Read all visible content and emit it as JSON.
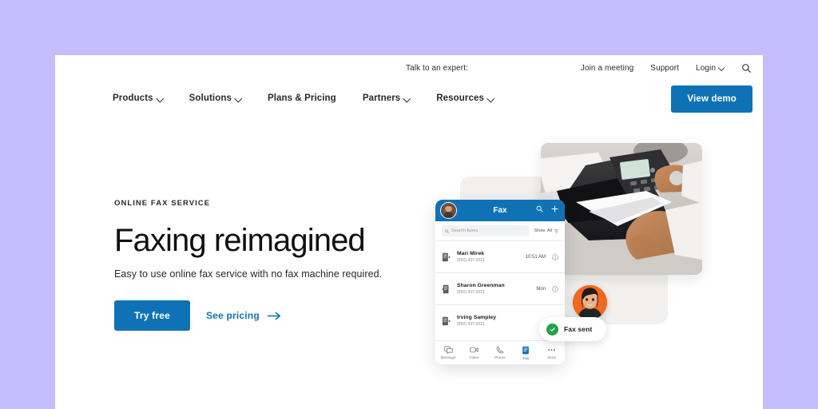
{
  "theme": {
    "page_background": "#c5bdfd",
    "surface": "#ffffff",
    "brand_blue": "#0f72b6",
    "text_dark": "#2b2926",
    "headline_color": "#13110e",
    "success_green": "#22a24a",
    "avatar_orange": "#f2681c",
    "card_gray": "#f1f0ee"
  },
  "utility_nav": {
    "expert_label": "Talk to an expert:",
    "links": [
      {
        "label": "Join a meeting",
        "has_chevron": false
      },
      {
        "label": "Support",
        "has_chevron": false
      },
      {
        "label": "Login",
        "has_chevron": true
      }
    ],
    "search_icon": "search-icon"
  },
  "main_nav": {
    "items": [
      {
        "label": "Products",
        "has_chevron": true
      },
      {
        "label": "Solutions",
        "has_chevron": true
      },
      {
        "label": "Plans & Pricing",
        "has_chevron": false
      },
      {
        "label": "Partners",
        "has_chevron": true
      },
      {
        "label": "Resources",
        "has_chevron": true
      }
    ],
    "cta_label": "View demo"
  },
  "hero": {
    "eyebrow": "ONLINE FAX SERVICE",
    "headline": "Faxing reimagined",
    "subhead": "Easy to use online fax service with no fax machine required.",
    "primary_cta": "Try free",
    "secondary_cta": "See pricing",
    "secondary_cta_icon": "arrow-right-icon"
  },
  "app_mockup": {
    "title": "Fax",
    "avatar_icon": "user-avatar",
    "bar_icons": [
      "search-icon",
      "plus-icon"
    ],
    "search_placeholder": "Search faxes",
    "filter_label": "Show: All",
    "filter_icon": "filter-icon",
    "rows": [
      {
        "icon": "fax-outgoing-icon",
        "name": "Mari Mirek",
        "number": "(650) 437-0221",
        "time": "10:51 AM",
        "info_icon": "info-icon"
      },
      {
        "icon": "fax-incoming-icon",
        "name": "Sharon Greenman",
        "number": "(650) 437-0221",
        "time": "Mon",
        "info_icon": "info-icon"
      },
      {
        "icon": "fax-outgoing-icon",
        "name": "Irving Sampley",
        "number": "(650) 437-0221",
        "time": "",
        "info_icon": "info-icon"
      }
    ],
    "tabs": [
      {
        "label": "Message",
        "icon": "message-icon",
        "active": false
      },
      {
        "label": "Video",
        "icon": "video-icon",
        "active": false
      },
      {
        "label": "Phone",
        "icon": "phone-icon",
        "active": false
      },
      {
        "label": "Fax",
        "icon": "fax-icon",
        "active": true
      },
      {
        "label": "More",
        "icon": "more-icon",
        "active": false
      }
    ]
  },
  "toast": {
    "label": "Fax sent",
    "icon": "check-circle-icon"
  },
  "photo": {
    "name": "fax-machine-photo",
    "description": "Hands feeding a document into an office fax machine"
  },
  "person_avatar": {
    "name": "smiling-woman-avatar"
  }
}
